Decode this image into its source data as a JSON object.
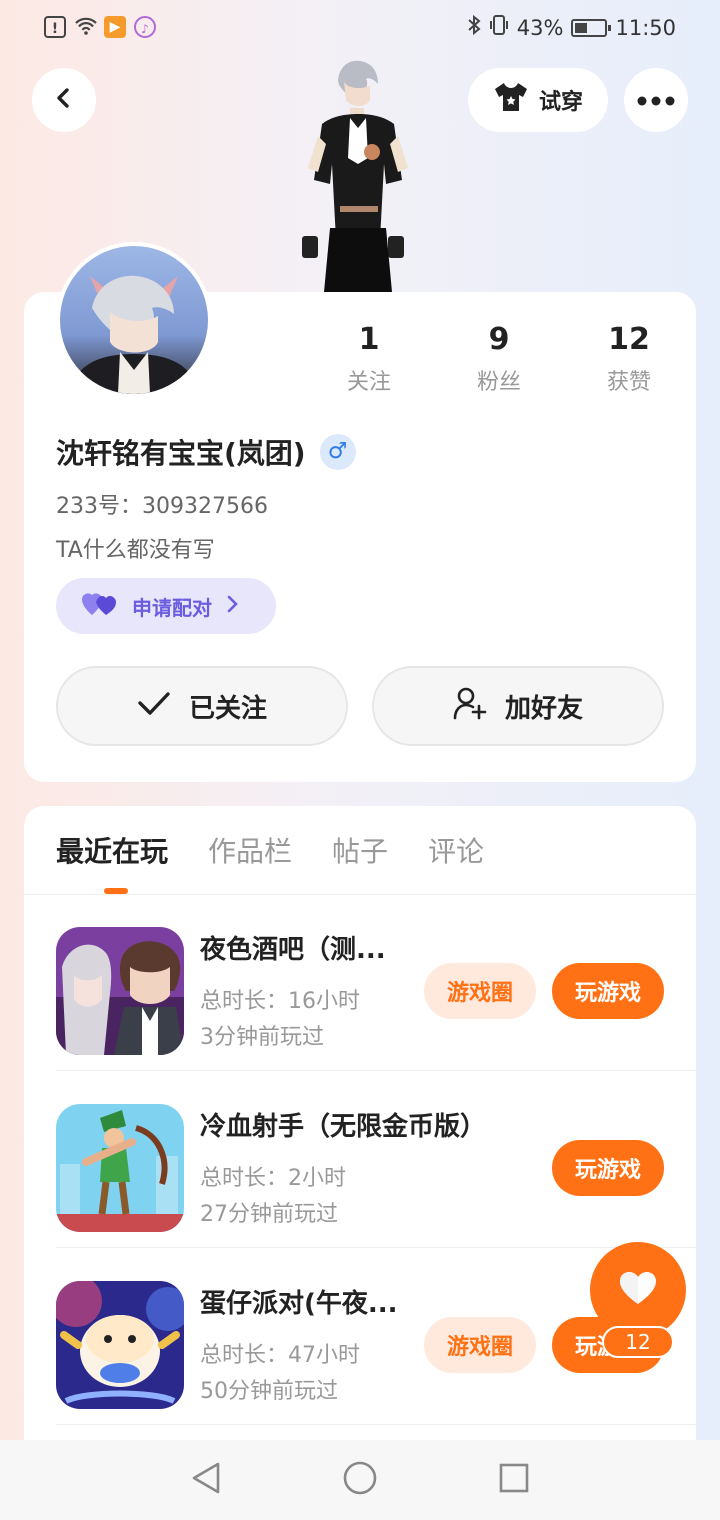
{
  "status_bar": {
    "battery": "43%",
    "time": "11:50",
    "battery_level": 0.43
  },
  "header": {
    "tryon_label": "试穿"
  },
  "profile": {
    "stats": [
      {
        "value": "1",
        "label": "关注"
      },
      {
        "value": "9",
        "label": "粉丝"
      },
      {
        "value": "12",
        "label": "获赞"
      }
    ],
    "name": "沈轩铭有宝宝(岚团)",
    "gender_symbol": "♂",
    "uid": "233号：309327566",
    "bio": "TA什么都没有写",
    "pair_label": "申请配对",
    "follow_label": "已关注",
    "add_friend_label": "加好友"
  },
  "tabs": [
    "最近在玩",
    "作品栏",
    "帖子",
    "评论"
  ],
  "games": [
    {
      "title": "夜色酒吧（测...",
      "duration": "总时长：16小时",
      "last_played": "3分钟前玩过",
      "circle_label": "游戏圈",
      "play_label": "玩游戏"
    },
    {
      "title": "冷血射手（无限金币版）",
      "duration": "总时长：2小时",
      "last_played": "27分钟前玩过",
      "play_label": "玩游戏"
    },
    {
      "title": "蛋仔派对(午夜...",
      "duration": "总时长：47小时",
      "last_played": "50分钟前玩过",
      "circle_label": "游戏圈",
      "play_label": "玩游戏"
    }
  ],
  "like": {
    "count": "12"
  },
  "colors": {
    "accent": "#ff7114",
    "pair_purple": "#6b5ce0",
    "gender_blue": "#2f7be6"
  }
}
